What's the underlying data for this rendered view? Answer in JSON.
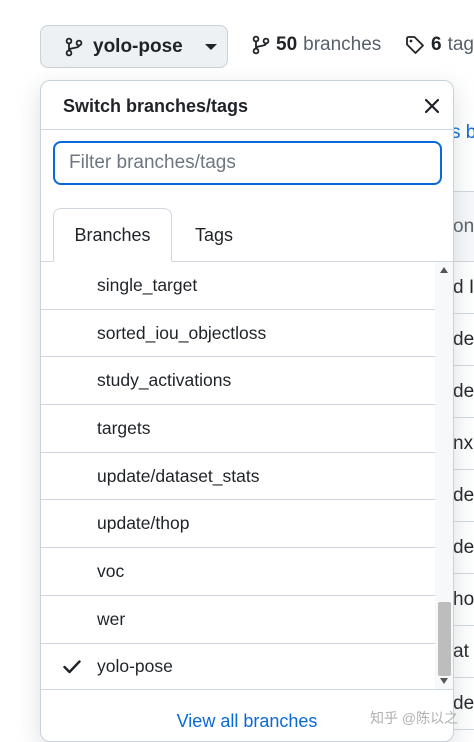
{
  "header": {
    "current_branch": "yolo-pose",
    "branches_count": "50",
    "branches_label": "branches",
    "tags_count": "6",
    "tags_label": "tag"
  },
  "background": {
    "link_text": "s b",
    "col_header": "on",
    "rows": [
      "d I",
      "de",
      "de",
      "nx",
      "de",
      "de",
      "hor",
      "at",
      "de"
    ]
  },
  "dropdown": {
    "title": "Switch branches/tags",
    "filter_placeholder": "Filter branches/tags",
    "tabs": [
      "Branches",
      "Tags"
    ],
    "active_tab": "Branches",
    "branches": [
      {
        "name": "single_target",
        "selected": false
      },
      {
        "name": "sorted_iou_objectloss",
        "selected": false
      },
      {
        "name": "study_activations",
        "selected": false
      },
      {
        "name": "targets",
        "selected": false
      },
      {
        "name": "update/dataset_stats",
        "selected": false
      },
      {
        "name": "update/thop",
        "selected": false
      },
      {
        "name": "voc",
        "selected": false
      },
      {
        "name": "wer",
        "selected": false
      },
      {
        "name": "yolo-pose",
        "selected": true
      }
    ],
    "view_all_label": "View all branches"
  },
  "watermark": "知乎 @陈以之",
  "colors": {
    "accent": "#0969da",
    "border": "#d0d7de",
    "button_bg": "#eef1f4"
  }
}
